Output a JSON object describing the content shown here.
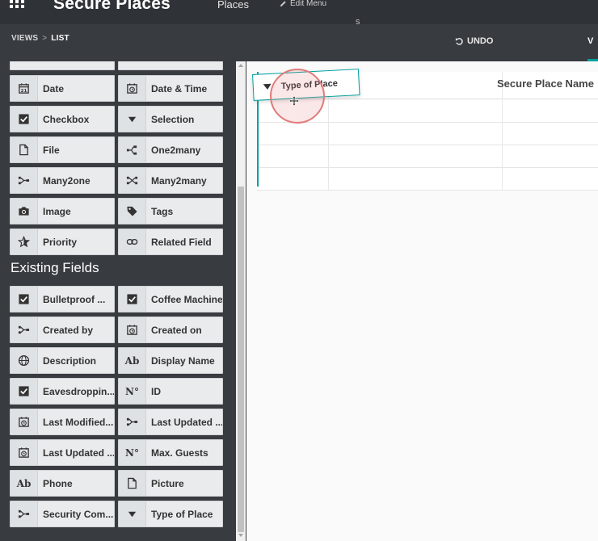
{
  "navbar": {
    "app_title": "Secure Places",
    "menu_places": "Places",
    "edit_menu": "Edit Menu"
  },
  "toolbar": {
    "breadcrumb": [
      "VIEWS",
      "LIST"
    ],
    "breadcrumb_sep": ">",
    "undo_label": "UNDO",
    "tab_partial": "V"
  },
  "sidebar": {
    "new_fields": [
      {
        "label": "Date",
        "icon": "calendar-icon"
      },
      {
        "label": "Date & Time",
        "icon": "calendar-clock-icon"
      },
      {
        "label": "Checkbox",
        "icon": "checkbox-icon"
      },
      {
        "label": "Selection",
        "icon": "caret-down-icon"
      },
      {
        "label": "File",
        "icon": "file-icon"
      },
      {
        "label": "One2many",
        "icon": "one2many-icon"
      },
      {
        "label": "Many2one",
        "icon": "many2one-icon"
      },
      {
        "label": "Many2many",
        "icon": "many2many-icon"
      },
      {
        "label": "Image",
        "icon": "camera-icon"
      },
      {
        "label": "Tags",
        "icon": "tag-icon"
      },
      {
        "label": "Priority",
        "icon": "star-icon"
      },
      {
        "label": "Related Field",
        "icon": "link-icon"
      }
    ],
    "existing_title": "Existing Fields",
    "existing_fields": [
      {
        "label": "Bulletproof ...",
        "icon": "checkbox-icon"
      },
      {
        "label": "Coffee Machine",
        "icon": "checkbox-icon"
      },
      {
        "label": "Created by",
        "icon": "many2one-icon"
      },
      {
        "label": "Created on",
        "icon": "calendar-clock-icon"
      },
      {
        "label": "Description",
        "icon": "globe-icon"
      },
      {
        "label": "Display Name",
        "icon": "text-ab-icon"
      },
      {
        "label": "Eavesdroppin...",
        "icon": "checkbox-icon"
      },
      {
        "label": "ID",
        "icon": "number-icon"
      },
      {
        "label": "Last Modified...",
        "icon": "calendar-clock-icon"
      },
      {
        "label": "Last Updated ...",
        "icon": "many2one-icon"
      },
      {
        "label": "Last Updated ...",
        "icon": "calendar-clock-icon"
      },
      {
        "label": "Max. Guests",
        "icon": "number-icon"
      },
      {
        "label": "Phone",
        "icon": "text-ab-icon"
      },
      {
        "label": "Picture",
        "icon": "file-icon"
      },
      {
        "label": "Security Com...",
        "icon": "many2one-icon"
      },
      {
        "label": "Type of Place",
        "icon": "caret-down-icon"
      }
    ]
  },
  "list": {
    "column_secure_place_name": "Secure Place Name",
    "partial_hidden_char": "s",
    "dragged_column": "Type of Place",
    "icon_text_ab": "Ab",
    "icon_text_no": "N°",
    "icon_text_21": "21"
  },
  "colors": {
    "accent": "#00a09d",
    "sidebar_bg": "#383c40",
    "navbar_bg": "#2f3236"
  }
}
